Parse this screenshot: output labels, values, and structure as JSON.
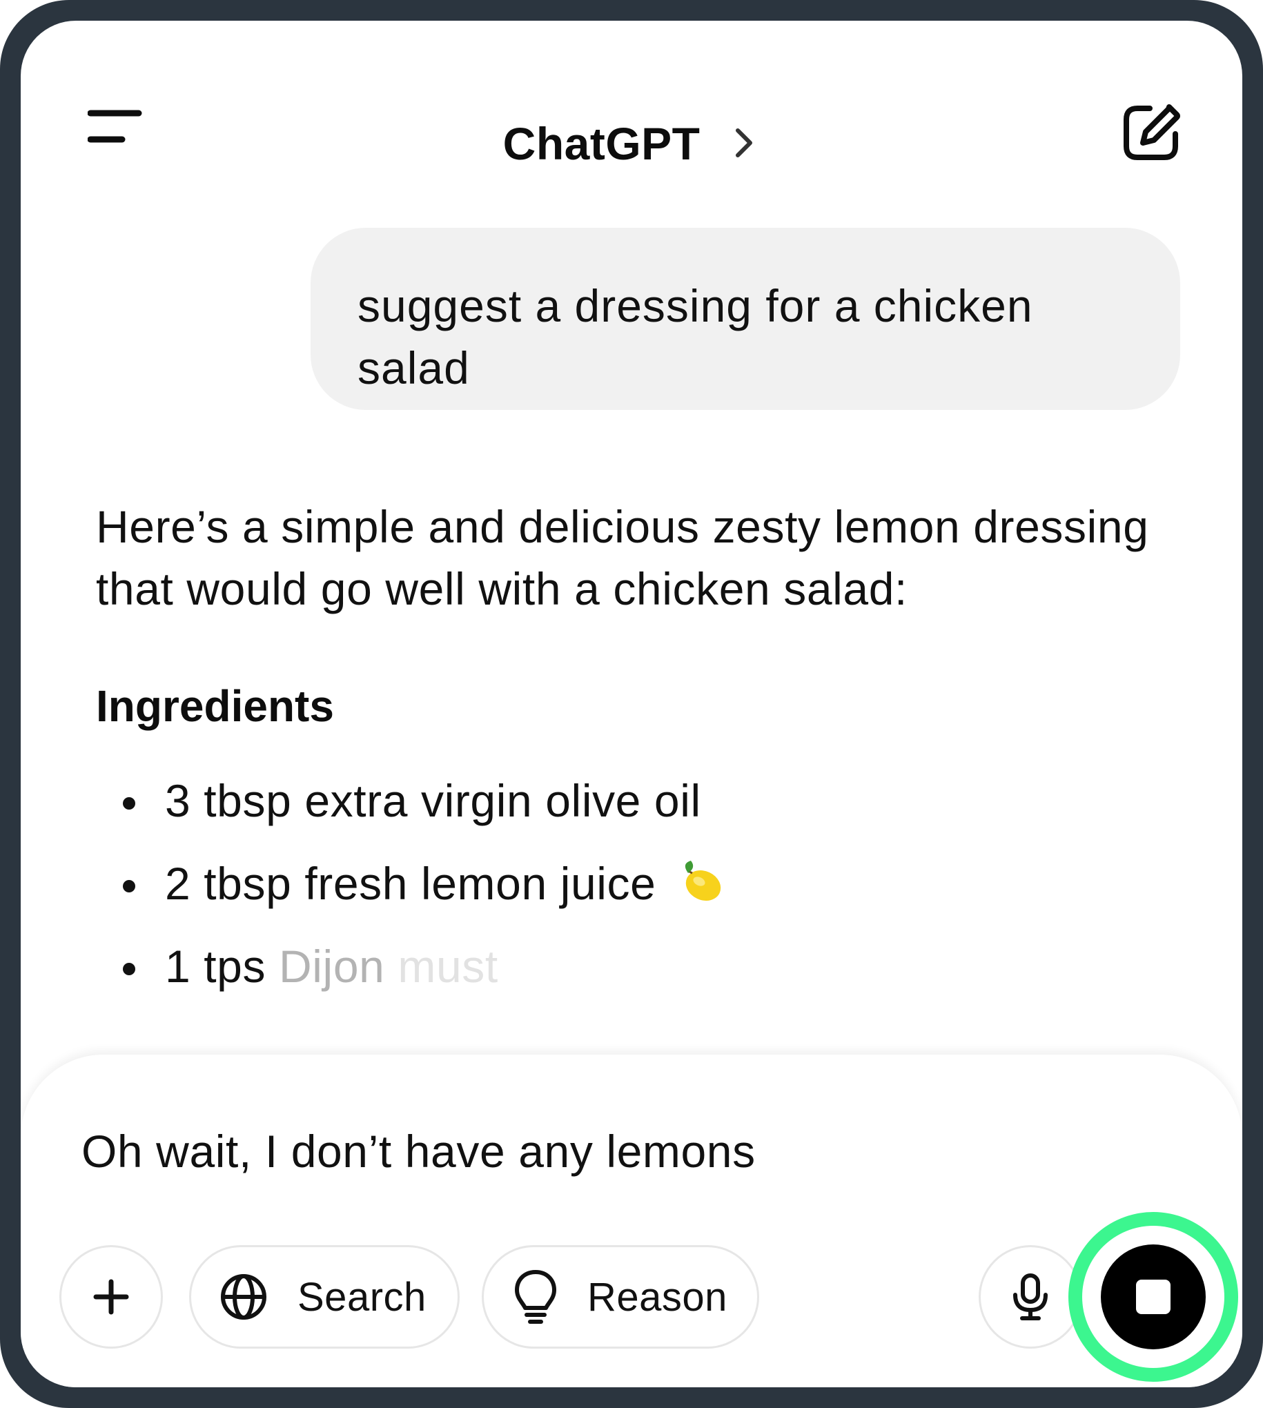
{
  "header": {
    "title": "ChatGPT",
    "menu_icon": "menu-icon",
    "chevron_icon": "chevron-right-icon",
    "new_chat_icon": "new-chat-icon"
  },
  "conversation": {
    "user_message_line1": "suggest a dressing for a chicken",
    "user_message_line2": "salad",
    "assistant_intro_line1": "Here’s a simple and delicious zesty lemon dressing",
    "assistant_intro_line2": "that would go well with a chicken salad:",
    "ingredients_heading": "Ingredients",
    "ingredients": [
      {
        "text": "3 tbsp extra virgin olive oil"
      },
      {
        "text": "2 tbsp fresh lemon juice",
        "emoji_icon": "lemon-icon"
      },
      {
        "text_solid": "1 tps",
        "text_fading": " Dijon ",
        "text_faded": "must"
      }
    ]
  },
  "composer": {
    "input_value": "Oh wait, I don’t have any lemons",
    "buttons": {
      "plus_icon": "plus-icon",
      "search_label": "Search",
      "search_icon": "globe-icon",
      "reason_label": "Reason",
      "reason_icon": "lightbulb-icon",
      "mic_icon": "microphone-icon",
      "stop_icon": "stop-icon"
    }
  },
  "colors": {
    "device_frame": "#2b353f",
    "bubble_bg": "#f1f1f1",
    "highlight_ring": "#3cf68f",
    "stop_button": "#000000"
  }
}
